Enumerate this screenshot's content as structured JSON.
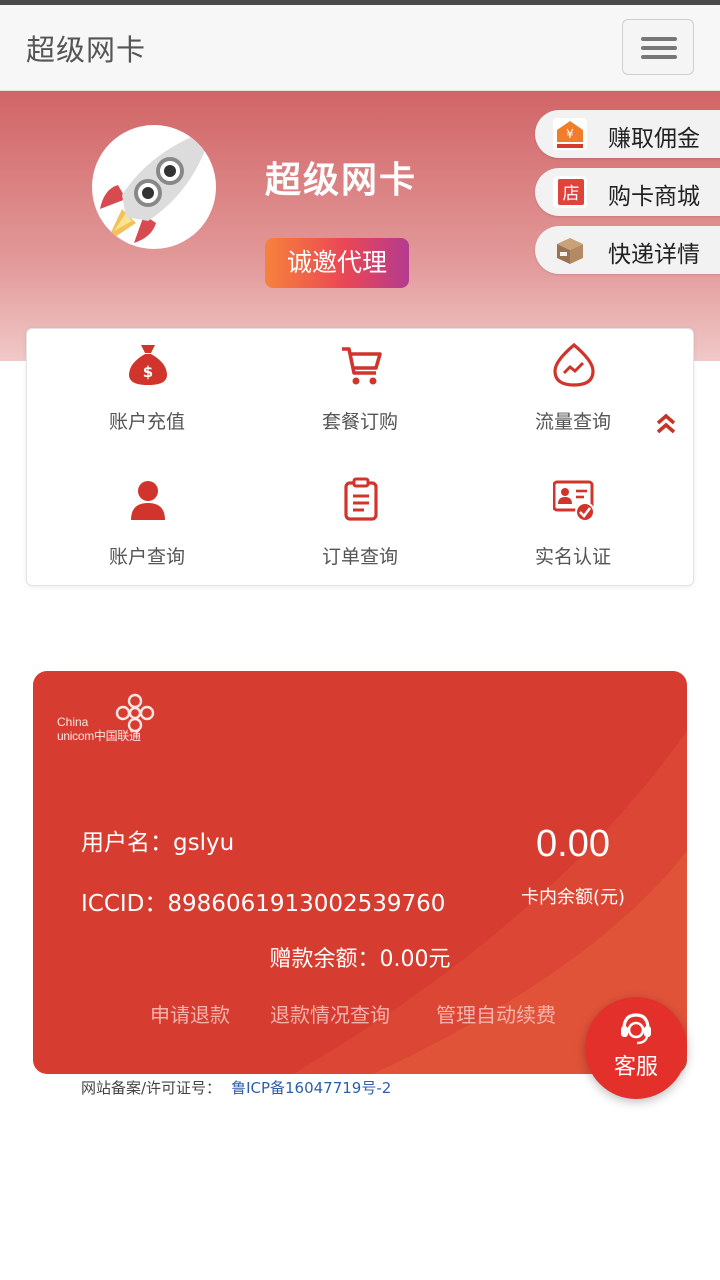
{
  "navbar": {
    "brand": "超级网卡"
  },
  "hero": {
    "title": "超级网卡",
    "invite_button": "诚邀代理"
  },
  "side_links": [
    {
      "label": "赚取佣金",
      "icon": "commission-icon"
    },
    {
      "label": "购卡商城",
      "icon": "store-icon"
    },
    {
      "label": "快递详情",
      "icon": "package-icon"
    }
  ],
  "grid": [
    {
      "label": "账户充值",
      "icon": "money-bag-icon"
    },
    {
      "label": "套餐订购",
      "icon": "cart-icon"
    },
    {
      "label": "流量查询",
      "icon": "data-drop-icon"
    },
    {
      "label": "账户查询",
      "icon": "user-icon"
    },
    {
      "label": "订单查询",
      "icon": "clipboard-icon"
    },
    {
      "label": "实名认证",
      "icon": "id-card-check-icon"
    }
  ],
  "card": {
    "logo_line1": "China",
    "logo_line2": "unicom中国联通",
    "username_label": "用户名：",
    "username": "gslyu",
    "iccid_label": "ICCID：",
    "iccid": "89860619130025397​60",
    "balance": "0.00",
    "balance_label": "卡内余额(元)",
    "gift_label": "赠款余额：",
    "gift_value": "0.00元",
    "links": [
      "申请退款",
      "退款情况查询",
      "管理自动续费"
    ]
  },
  "footer": {
    "icp_label": "网站备案/许可证号：",
    "icp_number": "鲁ICP备16047719号-2"
  },
  "customer_service": "客服",
  "colors": {
    "primary": "#d73c30",
    "accent": "#e4302a",
    "icon_red": "#d1342b"
  }
}
